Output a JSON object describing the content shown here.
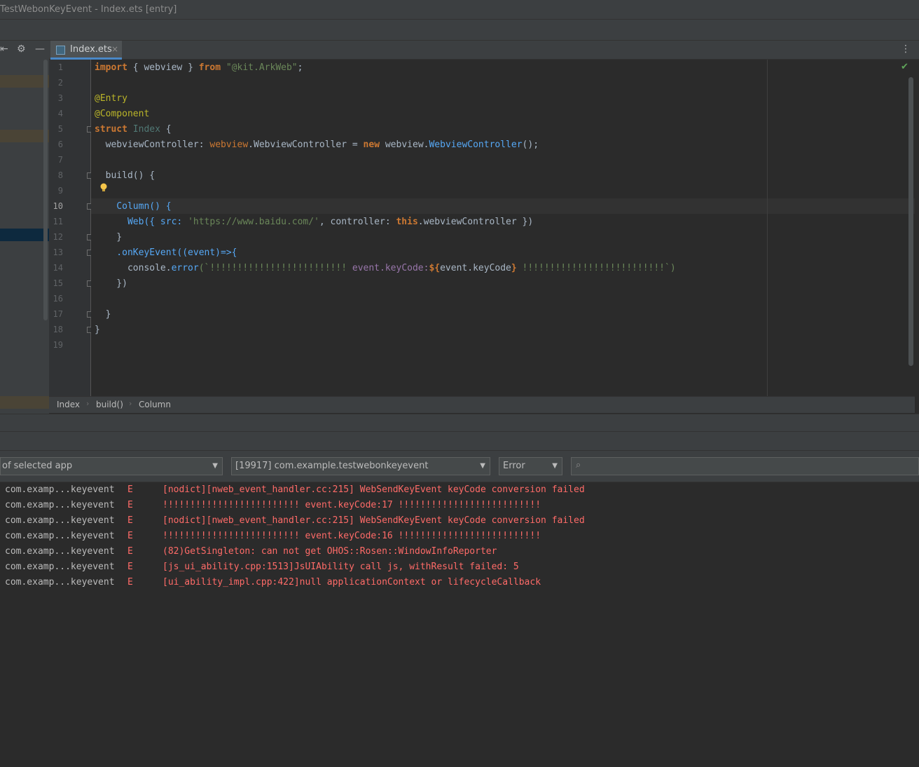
{
  "window": {
    "title": "TestWebonKeyEvent - Index.ets [entry]"
  },
  "tabs": [
    {
      "label": "Index.ets",
      "close": "×"
    }
  ],
  "editor": {
    "line_numbers": [
      "1",
      "2",
      "3",
      "4",
      "5",
      "6",
      "7",
      "8",
      "9",
      "10",
      "11",
      "12",
      "13",
      "14",
      "15",
      "16",
      "17",
      "18",
      "19"
    ],
    "current_line": "10",
    "code": [
      [
        "import",
        " { ",
        "webview",
        " } ",
        "from",
        " ",
        "\"@kit.ArkWeb\"",
        ";"
      ],
      [],
      [
        "@Entry"
      ],
      [
        "@Component"
      ],
      [
        "struct",
        " ",
        "Index",
        " {"
      ],
      [
        "  webviewController: ",
        "webview",
        ".WebviewController = ",
        "new",
        " webview.",
        "WebviewController",
        "();"
      ],
      [],
      [
        "  build() {"
      ],
      [],
      [
        "    Column() {"
      ],
      [
        "      Web({ src: ",
        "'https://www.baidu.com/'",
        ", controller: ",
        "this",
        ".webviewController })"
      ],
      [
        "    }"
      ],
      [
        "    .onKeyEvent((event)=>{"
      ],
      [
        "      console.",
        "error",
        "(`!!!!!!!!!!!!!!!!!!!!!!!!! ",
        "event.keyCode:",
        "${",
        "event.keyCode",
        "}",
        " !!!!!!!!!!!!!!!!!!!!!!!!!!`)"
      ],
      [
        "    })"
      ],
      [],
      [
        "  }"
      ],
      [
        "}"
      ],
      []
    ]
  },
  "breadcrumb": [
    "Index",
    "build()",
    "Column"
  ],
  "logcat": {
    "device_filter": "of selected app",
    "process_filter": "[19917] com.example.testwebonkeyevent",
    "level_filter": "Error",
    "search_placeholder": "",
    "rows": [
      {
        "tag": "com.examp...keyevent",
        "level": "E",
        "message": "[nodict][nweb_event_handler.cc:215] WebSendKeyEvent keyCode conversion failed"
      },
      {
        "tag": "com.examp...keyevent",
        "level": "E",
        "message": "!!!!!!!!!!!!!!!!!!!!!!!!! event.keyCode:17 !!!!!!!!!!!!!!!!!!!!!!!!!!"
      },
      {
        "tag": "com.examp...keyevent",
        "level": "E",
        "message": "[nodict][nweb_event_handler.cc:215] WebSendKeyEvent keyCode conversion failed"
      },
      {
        "tag": "com.examp...keyevent",
        "level": "E",
        "message": "!!!!!!!!!!!!!!!!!!!!!!!!! event.keyCode:16 !!!!!!!!!!!!!!!!!!!!!!!!!!"
      },
      {
        "tag": "com.examp...keyevent",
        "level": "E",
        "message": "(82)GetSingleton: can not get OHOS::Rosen::WindowInfoReporter"
      },
      {
        "tag": "com.examp...keyevent",
        "level": "E",
        "message": "[js_ui_ability.cpp:1513]JsUIAbility call js, withResult failed: 5"
      },
      {
        "tag": "com.examp...keyevent",
        "level": "E",
        "message": "[ui_ability_impl.cpp:422]null applicationContext or lifecycleCallback"
      }
    ]
  },
  "colors": {
    "log_error": "#ff6b68",
    "keyword": "#cc7832",
    "string": "#6a8759",
    "annotation": "#bbb529"
  }
}
